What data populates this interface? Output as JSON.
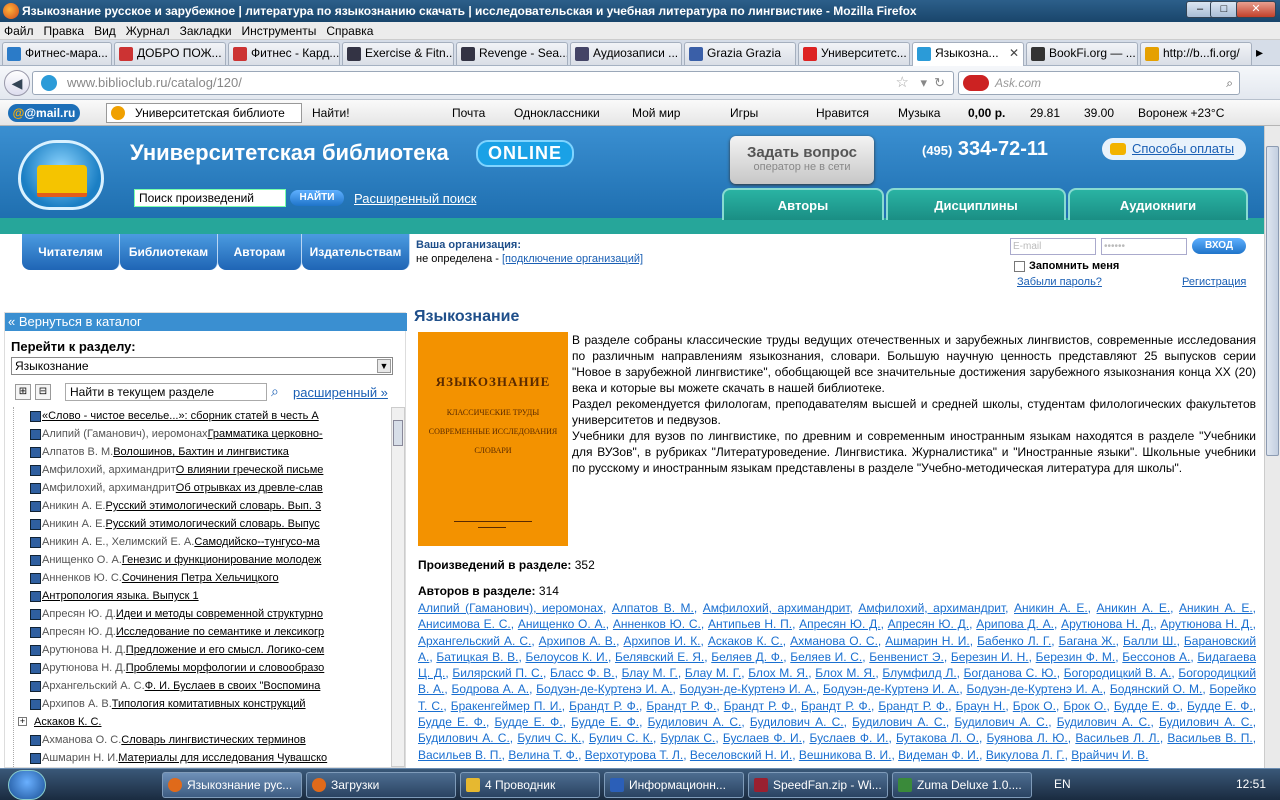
{
  "window": {
    "title": "Языкознание русское и зарубежное | литература по языкознанию скачать | исследовательская и учебная литература по лингвистике - Mozilla Firefox"
  },
  "menu": [
    "Файл",
    "Правка",
    "Вид",
    "Журнал",
    "Закладки",
    "Инструменты",
    "Справка"
  ],
  "tabs": [
    {
      "label": "Фитнес-мара...",
      "color": "#2b7bc8"
    },
    {
      "label": "ДОБРО ПОЖ...",
      "color": "#c33"
    },
    {
      "label": "Фитнес - Кард...",
      "color": "#c33"
    },
    {
      "label": "Exercise & Fitn...",
      "color": "#334"
    },
    {
      "label": "Revenge - Sea...",
      "color": "#334"
    },
    {
      "label": "Аудиозаписи ...",
      "color": "#446"
    },
    {
      "label": "Grazia Grazia",
      "color": "#3a5fa8"
    },
    {
      "label": "Университетс...",
      "color": "#d22"
    },
    {
      "label": "Языкозна...",
      "color": "#2b9bd8"
    },
    {
      "label": "BookFi.org — ...",
      "color": "#333"
    },
    {
      "label": "http://b...fi.org/",
      "color": "#e5a000"
    }
  ],
  "nav": {
    "url_host": "www.biblioclub.ru",
    "url_path": "/catalog/120/",
    "search_placeholder": "Ask.com"
  },
  "mailbar": {
    "logo": "@mail.ru",
    "search_value": "Университетская библиоте",
    "find": "Найти!",
    "items": [
      "Почта",
      "Одноклассники",
      "Мой мир",
      "Игры",
      "Нравится",
      "Музыка"
    ],
    "money": "0,00 р.",
    "usd": "29.81",
    "eur": "39.00",
    "weather": "Воронеж +23°C"
  },
  "site": {
    "title": "Университетская библиотека",
    "online": "ONLINE",
    "search_value": "Поиск произведений",
    "find_btn": "НАЙТИ",
    "adv_search": "Расширенный поиск",
    "ask_title": "Задать вопрос",
    "ask_sub": "оператор не в сети",
    "phone_code": "(495)",
    "phone": "334-72-11",
    "pay": "Способы оплаты",
    "green_tabs": [
      "Авторы",
      "Дисциплины",
      "Аудиокниги"
    ],
    "blue_tabs": [
      "Читателям",
      "Библиотекам",
      "Авторам",
      "Издательствам"
    ],
    "org_label": "Ваша организация:",
    "org_value": "не определена - ",
    "org_link": "[подключение организаций]",
    "email_ph": "E-mail",
    "pw_ph": "••••••",
    "enter_btn": "ВХОД",
    "remember": "Запомнить меня",
    "forgot": "Забыли пароль?",
    "register": "Регистрация"
  },
  "sidebar": {
    "back": "« Вернуться в каталог",
    "goto_label": "Перейти к разделу:",
    "section_selected": "Языкознание",
    "local_search": "Найти в текущем разделе",
    "adv": "расширенный »",
    "rows": [
      {
        "author": "",
        "title": "«Слово - чистое веселье...»: сборник статей в честь А"
      },
      {
        "author": "Алипий (Гаманович), иеромонах",
        "title": "Грамматика церковно-"
      },
      {
        "author": "Алпатов В. М.",
        "title": "Волошинов, Бахтин и лингвистика"
      },
      {
        "author": "Амфилохий, архимандрит",
        "title": "О влиянии греческой письме"
      },
      {
        "author": "Амфилохий, архимандрит",
        "title": "Об отрывках из древле-слав"
      },
      {
        "author": "Аникин А. Е.",
        "title": "Русский этимологический словарь. Вып. 3"
      },
      {
        "author": "Аникин А. Е.",
        "title": "Русский этимологический словарь. Выпус"
      },
      {
        "author": "Аникин А. Е., Хелимский Е. А.",
        "title": "Самодийско--тунгусо-ма"
      },
      {
        "author": "Анищенко О. А.",
        "title": "Генезис и функционирование молодеж"
      },
      {
        "author": "Анненков Ю. С.",
        "title": "Сочинения Петра Хельчицкого"
      },
      {
        "author": "",
        "title": "Антропология языка. Выпуск 1"
      },
      {
        "author": "Апресян Ю. Д.",
        "title": "Идеи и методы современной структурно"
      },
      {
        "author": "Апресян Ю. Д.",
        "title": "Исследование по семантике и лексикогр"
      },
      {
        "author": "Арутюнова Н. Д.",
        "title": "Предложение и его смысл. Логико-сем"
      },
      {
        "author": "Арутюнова Н. Д.",
        "title": "Проблемы морфологии и словообразо"
      },
      {
        "author": "Архангельский А. С.",
        "title": "Ф. И. Буслаев в своих \"Воспомина"
      },
      {
        "author": "Архипов А. В.",
        "title": "Типология комитативных конструкций"
      },
      {
        "author": "",
        "title": "Аскаков К. С.",
        "folder": true
      },
      {
        "author": "Ахманова О. С.",
        "title": "Словарь лингвистических терминов"
      },
      {
        "author": "Ашмарин Н. И.",
        "title": "Материалы для исследования Чувашско"
      }
    ]
  },
  "main": {
    "heading": "Языкознание",
    "cover": {
      "t1": "ЯЗЫКОЗНАНИЕ",
      "t2": "КЛАССИЧЕСКИЕ ТРУДЫ",
      "t3": "СОВРЕМЕННЫЕ ИССЛЕДОВАНИЯ",
      "t4": "СЛОВАРИ"
    },
    "p1": "В разделе собраны классические труды ведущих отечественных и зарубежных лингвистов, современные исследования по различным направлениям языкознания, словари. Большую научную ценность представляют 25 выпусков серии \"Новое в зарубежной лингвистике\", обобщающей все значительные достижения зарубежного языкознания конца XX (20) века и которые вы можете скачать в нашей библиотеке.",
    "p2": "Раздел рекомендуется филологам, преподавателям высшей и средней школы, студентам филологических факультетов университетов и педвузов.",
    "p3": "Учебники для вузов по лингвистике, по древним и современным иностранным языкам находятся в разделе \"Учебники для ВУЗов\", в рубриках \"Литературоведение. Лингвистика. Журналистика\" и \"Иностранные языки\". Школьные учебники по русскому и иностранным языкам представлены в разделе \"Учебно-методическая литература для школы\".",
    "works_label": "Произведений в разделе:",
    "works_count": "352",
    "authors_label": "Авторов в разделе:",
    "authors_count": "314",
    "authors": [
      "Алипий (Гаманович), иеромонах",
      "Алпатов В. М.",
      "Амфилохий, архимандрит",
      "Амфилохий, архимандрит",
      "Аникин А. Е.",
      "Аникин А. Е.",
      "Аникин А. Е.",
      "Анисимова Е. С.",
      "Анищенко О. А.",
      "Анненков Ю. С.",
      "Антипьев Н. П.",
      "Апресян Ю. Д.",
      "Апресян Ю. Д.",
      "Арипова Д. А.",
      "Арутюнова Н. Д.",
      "Арутюнова Н. Д.",
      "Архангельский А. С.",
      "Архипов А. В.",
      "Архипов И. К.",
      "Аскаков К. С.",
      "Ахманова О. С.",
      "Ашмарин Н. И.",
      "Бабенко Л. Г.",
      "Багана Ж.",
      "Балли Ш.",
      "Барановский А.",
      "Батицкая В. В.",
      "Белоусов К. И.",
      "Белявский Е. Я.",
      "Беляев Д. Ф.",
      "Беляев И. С.",
      "Бенвенист Э.",
      "Березин И. Н.",
      "Березин Ф. М.",
      "Бессонов А.",
      "Бидагаева Ц. Д.",
      "Билярский П. С.",
      "Бласс Ф. В.",
      "Блау М. Г.",
      "Блау М. Г.",
      "Блох М. Я.",
      "Блох М. Я.",
      "Блумфилд Л.",
      "Богданова С. Ю.",
      "Богородицкий В. А.",
      "Богородицкий В. А.",
      "Бодрова А. А.",
      "Бодуэн-де-Куртенэ И. А.",
      "Бодуэн-де-Куртенэ И. А.",
      "Бодуэн-де-Куртенэ И. А.",
      "Бодуэн-де-Куртенэ И. А.",
      "Бодянский О. М.",
      "Борейко Т. С.",
      "Бракенгеймер П. И.",
      "Брандт Р. Ф.",
      "Брандт Р. Ф.",
      "Брандт Р. Ф.",
      "Брандт Р. Ф.",
      "Брандт Р. Ф.",
      "Браун Н.",
      "Брок О.",
      "Брок О.",
      "Будде Е. Ф.",
      "Будде Е. Ф.",
      "Будде Е. Ф.",
      "Будде Е. Ф.",
      "Будде Е. Ф.",
      "Будилович А. С.",
      "Будилович А. С.",
      "Будилович А. С.",
      "Будилович А. С.",
      "Будилович А. С.",
      "Будилович А. С.",
      "Будилович А. С.",
      "Булич С. К.",
      "Булич С. К.",
      "Бурлак С.",
      "Буслаев Ф. И.",
      "Буслаев Ф. И.",
      "Бутакова Л. О.",
      "Буянова Л. Ю.",
      "Васильев Л. Л.",
      "Васильев В. П.",
      "Васильев В. П.",
      "Велина Т. Ф.",
      "Верхотурова Т. Л.",
      "Веселовский Н. И.",
      "Вешникова В. И.",
      "Видеман Ф. И.",
      "Викулова Л. Г.",
      "Врайчич И. В."
    ]
  },
  "taskbar": {
    "tasks": [
      {
        "label": "Языкознание рус...",
        "color": "#e06a1a",
        "active": true
      },
      {
        "label": "Загрузки",
        "color": "#e06a1a"
      },
      {
        "label": "4 Проводник",
        "color": "#e6b830"
      },
      {
        "label": "Информационн...",
        "color": "#2b5fb8"
      },
      {
        "label": "SpeedFan.zip - Wi...",
        "color": "#9a2030"
      },
      {
        "label": "Zuma Deluxe 1.0....",
        "color": "#3a8a3a"
      }
    ],
    "lang": "EN",
    "time": "12:51"
  }
}
